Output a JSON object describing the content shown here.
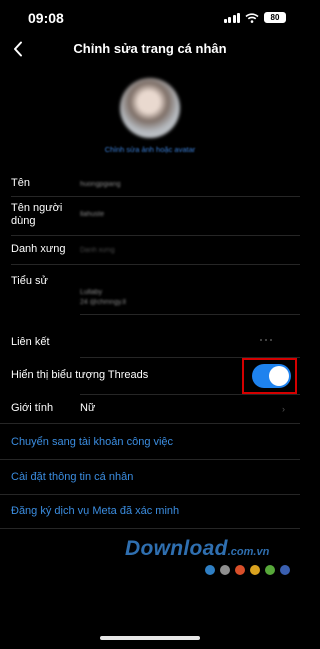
{
  "status_bar": {
    "time": "09:08",
    "battery": "80"
  },
  "nav": {
    "title": "Chỉnh sửa trang cá nhân"
  },
  "profile": {
    "edit_photo_label": "Chỉnh sửa ảnh hoặc avatar"
  },
  "fields": {
    "name": {
      "label": "Tên",
      "value": "huongpgiang"
    },
    "username": {
      "label": "Tên người dùng",
      "value": "llahuste"
    },
    "pronouns": {
      "label": "Danh xưng",
      "value": "Danh xưng"
    },
    "bio": {
      "label": "Tiểu sử",
      "lines": [
        "",
        "Lullaby",
        "24 @chmngy.ll"
      ]
    },
    "links": {
      "label": "Liên kết"
    },
    "threads": {
      "label": "Hiển thị biểu tượng Threads",
      "enabled": true
    },
    "gender": {
      "label": "Giới tính",
      "value": "Nữ"
    }
  },
  "links": {
    "switch_account": "Chuyển sang tài khoản công việc",
    "personal_info": "Cài đặt thông tin cá nhân",
    "meta_verified": "Đăng ký dịch vụ Meta đã xác minh"
  },
  "watermark": {
    "text": "Download",
    "suffix": ".com.vn",
    "dot_colors": [
      "#2f7fc4",
      "#8f8f8f",
      "#d94f2a",
      "#d9a21f",
      "#57a83a",
      "#3a5fb0"
    ]
  },
  "colors": {
    "accent": "#3b8de0",
    "toggle_on": "#1e82ee",
    "highlight_box": "#d40000"
  }
}
